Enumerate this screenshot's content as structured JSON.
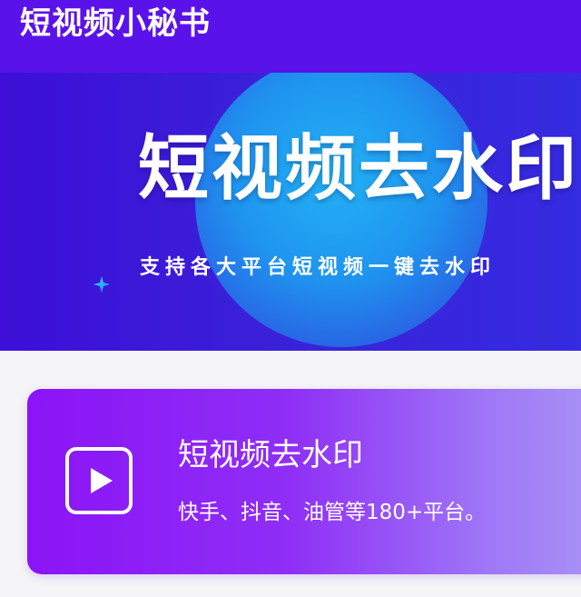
{
  "app_bar": {
    "title": "短视频小秘书",
    "color": "#5a12ea"
  },
  "banner": {
    "title": "短视频去水印",
    "subtitle": "支持各大平台短视频一键去水印",
    "colors": {
      "background": "#3a1ed8",
      "circle": "#1f94ef"
    },
    "decoration_icon": "sparkle-icon"
  },
  "feature_card": {
    "icon": "play-icon",
    "title": "短视频去水印",
    "description": "快手、抖音、油管等180+平台。",
    "gradient": [
      "#8b14f6",
      "#a996f6"
    ]
  }
}
